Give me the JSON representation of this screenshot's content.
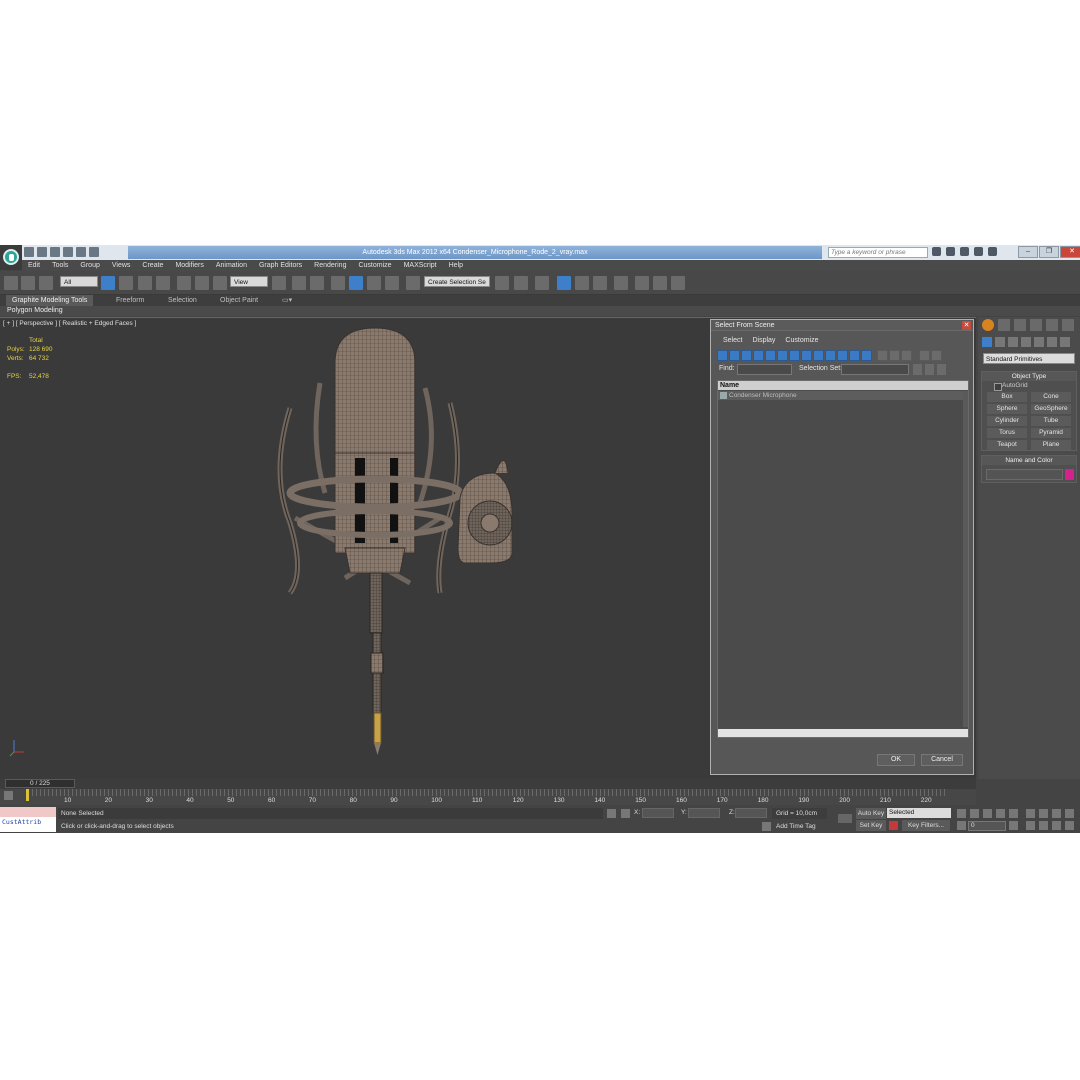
{
  "window": {
    "title": "Autodesk 3ds Max  2012 x64      Condenser_Microphone_Rode_2_vray.max",
    "search_placeholder": "Type a keyword or phrase"
  },
  "menu": [
    "Edit",
    "Tools",
    "Group",
    "Views",
    "Create",
    "Modifiers",
    "Animation",
    "Graph Editors",
    "Rendering",
    "Customize",
    "MAXScript",
    "Help"
  ],
  "toolbar": {
    "selection_filter": "All",
    "ref_coord": "View",
    "named_selection": "Create Selection Se"
  },
  "ribbon": {
    "tabs": [
      "Graphite Modeling Tools",
      "Freeform",
      "Selection",
      "Object Paint"
    ],
    "subpanel": "Polygon Modeling"
  },
  "viewport": {
    "label": "[ + ] [ Perspective ] [ Realistic + Edged Faces ]",
    "stats_total": "Total",
    "polys_label": "Polys:",
    "polys_value": "128 690",
    "verts_label": "Verts:",
    "verts_value": "64 732",
    "fps_label": "FPS:",
    "fps_value": "52,478"
  },
  "dialog": {
    "title": "Select From Scene",
    "menu": [
      "Select",
      "Display",
      "Customize"
    ],
    "find_label": "Find:",
    "selection_set_label": "Selection Set:",
    "column_name": "Name",
    "item": "Condenser Microphone",
    "ok": "OK",
    "cancel": "Cancel"
  },
  "command_panel": {
    "dropdown": "Standard Primitives",
    "object_type": "Object Type",
    "autogrid": "AutoGrid",
    "buttons": [
      "Box",
      "Cone",
      "Sphere",
      "GeoSphere",
      "Cylinder",
      "Tube",
      "Torus",
      "Pyramid",
      "Teapot",
      "Plane"
    ],
    "name_and_color": "Name and Color",
    "color": "#d4218b"
  },
  "timeline": {
    "frame": "0 / 225",
    "ticks": [
      "10",
      "20",
      "30",
      "40",
      "50",
      "60",
      "70",
      "80",
      "90",
      "100",
      "110",
      "120",
      "130",
      "140",
      "150",
      "160",
      "170",
      "180",
      "190",
      "200",
      "210",
      "220"
    ]
  },
  "status": {
    "maxscript": "CustAttrib",
    "selection": "None Selected",
    "prompt": "Click or click-and-drag to select objects",
    "x_label": "X:",
    "y_label": "Y:",
    "z_label": "Z:",
    "grid": "Grid = 10,0cm",
    "add_time_tag": "Add Time Tag",
    "auto_key": "Auto Key",
    "set_key": "Set Key",
    "selected": "Selected",
    "key_filters": "Key Filters...",
    "frame_value": "0"
  }
}
